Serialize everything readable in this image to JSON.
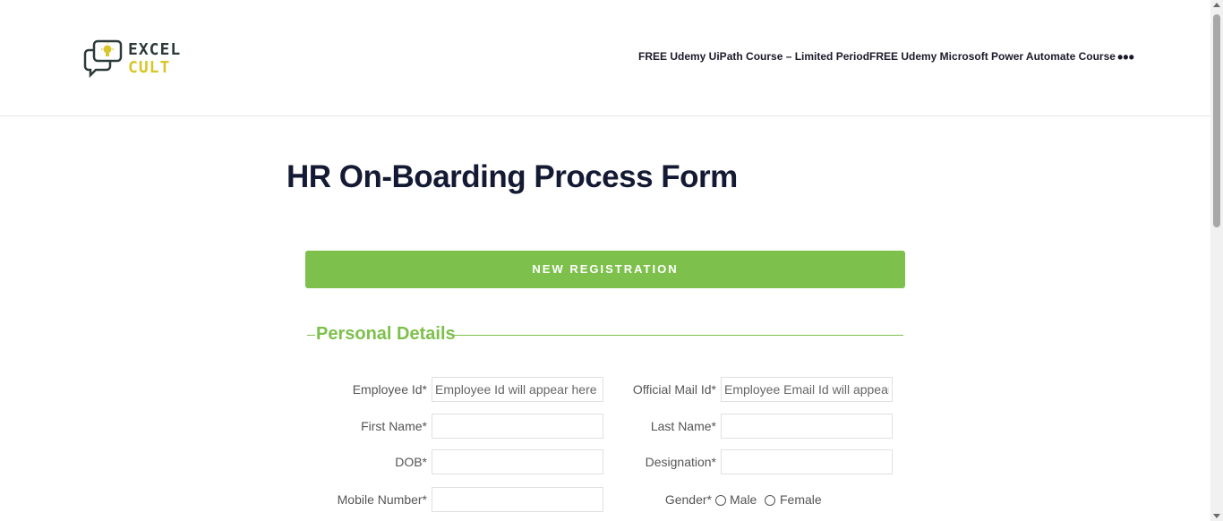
{
  "header": {
    "logo": {
      "line1": "EXCEL",
      "line2": "CULT"
    },
    "nav": [
      {
        "label": "FREE Udemy UiPath Course – Limited Period"
      },
      {
        "label": "FREE Udemy Microsoft Power Automate Course"
      }
    ],
    "more_label": "•••"
  },
  "main": {
    "title": "HR On-Boarding Process Form",
    "registration_button": "NEW REGISTRATION",
    "section_title": "Personal Details",
    "fields": {
      "employee_id": {
        "label": "Employee Id*",
        "placeholder": "Employee Id will appear here"
      },
      "official_mail": {
        "label": "Official Mail Id*",
        "placeholder": "Employee Email Id will appear here"
      },
      "first_name": {
        "label": "First Name*",
        "placeholder": ""
      },
      "last_name": {
        "label": "Last Name*",
        "placeholder": ""
      },
      "dob": {
        "label": "DOB*",
        "placeholder": ""
      },
      "designation": {
        "label": "Designation*",
        "placeholder": ""
      },
      "mobile": {
        "label": "Mobile Number*",
        "placeholder": ""
      },
      "gender": {
        "label": "Gender*",
        "options": [
          "Male",
          "Female"
        ]
      }
    }
  },
  "colors": {
    "accent": "#7dc04b",
    "title": "#141a33",
    "logo_dark": "#2d3a3a",
    "logo_yellow": "#d8c72a"
  }
}
